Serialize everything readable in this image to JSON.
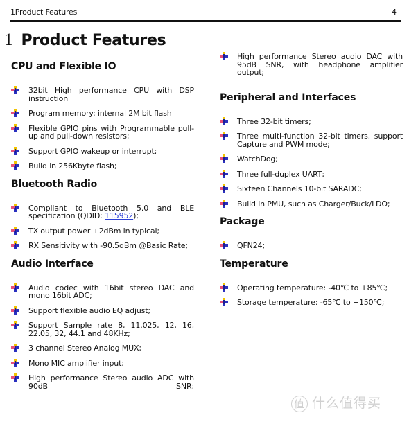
{
  "header": {
    "running_title": "1Product Features",
    "page_number": "4"
  },
  "chapter": {
    "number": "1",
    "title": "Product Features"
  },
  "colors": {
    "link": "#2a3fd6",
    "text": "#111111",
    "bullet_yellow": "#f2c400",
    "bullet_red": "#e8507a",
    "bullet_blue": "#2a2fbf"
  },
  "bullet_icon": "four-point-star-bullet-icon",
  "sections": {
    "cpu": {
      "heading": "CPU and Flexible IO",
      "items": [
        "32bit High performance CPU with DSP instruction",
        "Program memory: internal 2M bit flash",
        "Flexible GPIO pins with Programmable pull-up and pull-down resistors;",
        "Support GPIO wakeup or interrupt;",
        "Build in 256Kbyte flash;"
      ]
    },
    "bluetooth": {
      "heading": "Bluetooth Radio",
      "item0_prefix": "Compliant to Bluetooth 5.0 and BLE specification (QDID: ",
      "item0_link": "115952",
      "item0_suffix": ");",
      "items": [
        "TX output power +2dBm in typical;",
        "RX Sensitivity with -90.5dBm @Basic Rate;"
      ]
    },
    "audio": {
      "heading": "Audio Interface",
      "items": [
        "Audio codec with 16bit stereo DAC and mono 16bit ADC;",
        "Support flexible audio EQ adjust;",
        "Support Sample rate 8, 11.025, 12, 16, 22.05, 32, 44.1 and 48KHz;",
        "3 channel Stereo Analog MUX;",
        "Mono MIC amplifier input;",
        "High performance Stereo audio ADC with 90dB SNR;",
        "High performance Stereo audio DAC with 95dB SNR, with headphone amplifier output;"
      ]
    },
    "peripheral": {
      "heading": "Peripheral and Interfaces",
      "items": [
        "Three 32-bit timers;",
        "Three multi-function 32-bit timers, support Capture and PWM mode;",
        "WatchDog;",
        "Three full-duplex UART;",
        "Sixteen Channels 10-bit SARADC;",
        "Build in PMU, such as Charger/Buck/LDO;"
      ]
    },
    "package": {
      "heading": "Package",
      "items": [
        "QFN24;"
      ]
    },
    "temperature": {
      "heading": "Temperature",
      "items": [
        "Operating temperature: -40℃  to +85℃;",
        "Storage temperature: -65℃  to +150℃;"
      ]
    }
  },
  "watermark": {
    "badge": "值",
    "text": "什么值得买"
  }
}
